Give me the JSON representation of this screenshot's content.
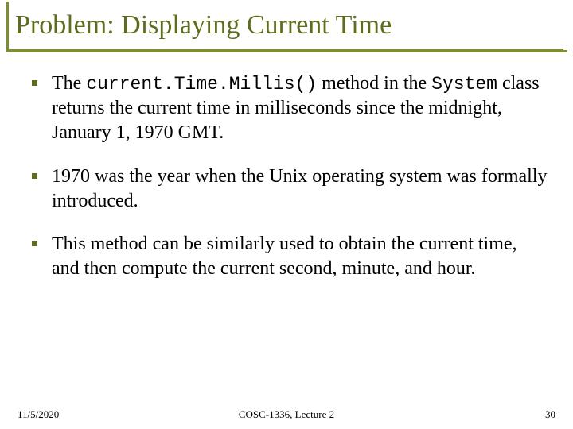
{
  "title": "Problem: Displaying Current Time",
  "bullets": {
    "b0": {
      "pre": "The ",
      "code1": "current.Time.Millis()",
      "mid": " method in the ",
      "code2": "System",
      "post": " class returns the current time in milliseconds since the midnight, January 1, 1970 GMT."
    },
    "b1": "1970 was the year when the Unix operating system was formally introduced.",
    "b2": "This method can be similarly used to obtain the current time, and then compute the current second, minute, and hour."
  },
  "footer": {
    "date": "11/5/2020",
    "center": "COSC-1336, Lecture 2",
    "page": "30"
  }
}
